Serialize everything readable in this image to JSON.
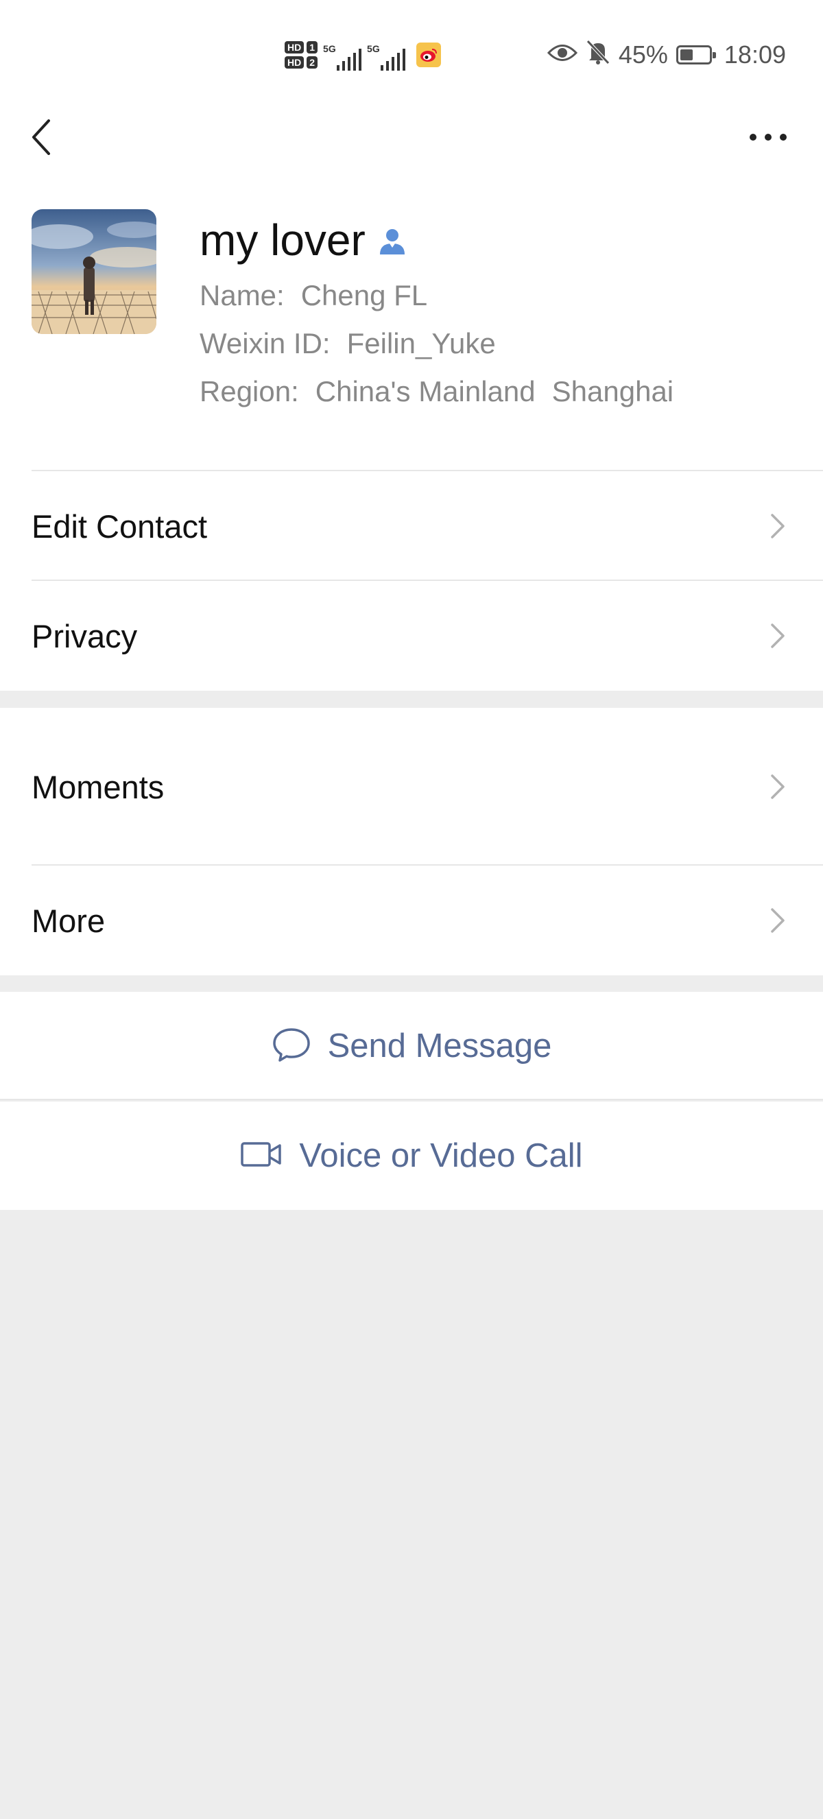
{
  "status_bar": {
    "hd1": "HD",
    "hd1_num": "1",
    "hd2": "HD",
    "hd2_num": "2",
    "net1": "5G",
    "net2": "5G",
    "battery_percent": "45%",
    "battery_level": 0.45,
    "time": "18:09"
  },
  "profile": {
    "nickname": "my lover",
    "name_label": "Name:",
    "name_value": "Cheng FL",
    "weixin_label": "Weixin ID:",
    "weixin_value": "Feilin_Yuke",
    "region_label": "Region:",
    "region_country": "China's Mainland",
    "region_city": "Shanghai"
  },
  "menu": {
    "edit_contact": "Edit Contact",
    "privacy": "Privacy",
    "moments": "Moments",
    "more": "More"
  },
  "actions": {
    "send_message": "Send Message",
    "voice_video_call": "Voice or Video Call"
  },
  "colors": {
    "link_blue": "#576b95",
    "contact_icon_blue": "#5b8fd8",
    "background_gray": "#ededed"
  }
}
